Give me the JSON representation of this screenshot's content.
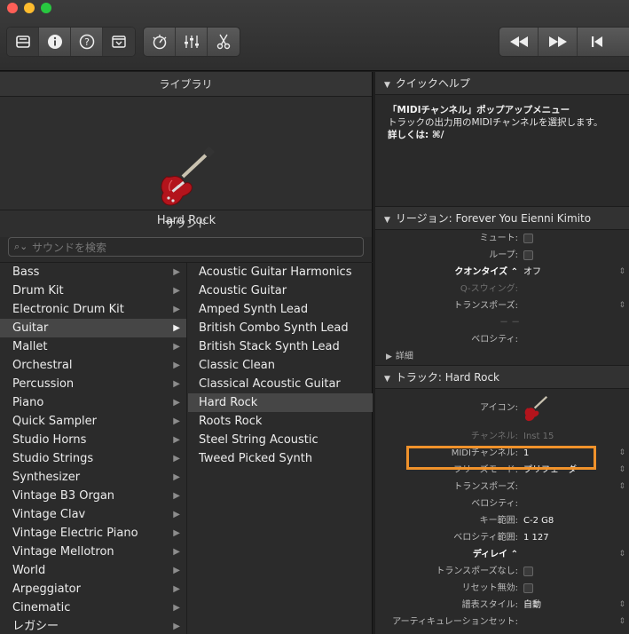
{
  "toolbar": {
    "left_group": [
      "library-icon",
      "inspector-icon",
      "quick-help-icon",
      "toolbar-icon"
    ],
    "middle_group": [
      "smart-controls-icon",
      "mixer-icon",
      "editors-icon"
    ],
    "transport": [
      "rewind-icon",
      "fast-forward-icon",
      "go-to-beginning-icon"
    ]
  },
  "library": {
    "header": "ライブラリ",
    "preview_name": "Hard Rock",
    "sound_header": "サウンド",
    "search_placeholder": "サウンドを検索",
    "categories": [
      "Bass",
      "Drum Kit",
      "Electronic Drum Kit",
      "Guitar",
      "Mallet",
      "Orchestral",
      "Percussion",
      "Piano",
      "Quick Sampler",
      "Studio Horns",
      "Studio Strings",
      "Synthesizer",
      "Vintage B3 Organ",
      "Vintage Clav",
      "Vintage Electric Piano",
      "Vintage Mellotron",
      "World",
      "Arpeggiator",
      "Cinematic",
      "レガシー"
    ],
    "selected_category": "Guitar",
    "patches": [
      "Acoustic Guitar Harmonics",
      "Acoustic Guitar",
      "Amped Synth Lead",
      "British Combo Synth Lead",
      "British Stack Synth Lead",
      "Classic Clean",
      "Classical Acoustic Guitar",
      "Hard Rock",
      "Roots Rock",
      "Steel String Acoustic",
      "Tweed Picked Synth"
    ],
    "selected_patch": "Hard Rock"
  },
  "quick_help": {
    "header": "クイックヘルプ",
    "title": "「MIDIチャンネル」ポップアップメニュー",
    "body": "トラックの出力用のMIDIチャンネルを選択します。",
    "more": "詳しくは: ⌘/"
  },
  "region": {
    "header": "リージョン: Forever You Eienni Kimito",
    "props": {
      "mute": "ミュート:",
      "loop": "ループ:",
      "quantize_label": "クオンタイズ",
      "quantize_value": "オフ",
      "q_swing": "Q-スウィング:",
      "transpose": "トランスポーズ:",
      "dashes": "－ －",
      "velocity": "ベロシティ:"
    },
    "detail": "詳細"
  },
  "track": {
    "header": "トラック:  Hard Rock",
    "props": {
      "icon": "アイコン:",
      "channel": "チャンネル:",
      "channel_value": "Inst 15",
      "midi_channel": "MIDIチャンネル:",
      "midi_channel_value": "1",
      "freeze_mode": "フリーズモード:",
      "freeze_mode_value": "プリフェーダー",
      "transpose": "トランスポーズ:",
      "velocity": "ベロシティ:",
      "key_range": "キー範囲:",
      "key_range_value": "C-2  G8",
      "velocity_range": "ベロシティ範囲:",
      "velocity_range_value": "1  127",
      "delay": "ディレイ",
      "no_transpose": "トランスポーズなし:",
      "no_reset": "リセット無効:",
      "staff_style": "譜表スタイル:",
      "staff_style_value": "自動",
      "articulation_set": "アーティキュレーションセット:"
    }
  },
  "colors": {
    "highlight": "#f0922b",
    "guitar": "#b3141c"
  }
}
